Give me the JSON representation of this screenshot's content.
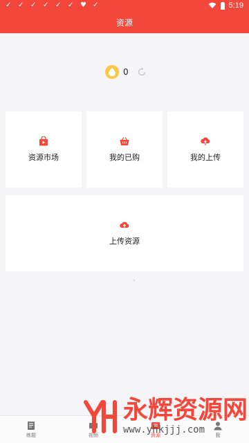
{
  "status_bar": {
    "time": "5:19"
  },
  "header": {
    "title": "资源"
  },
  "balance": {
    "value": "0"
  },
  "cards": [
    {
      "label": "资源市场",
      "icon": "shopping-bag-icon"
    },
    {
      "label": "我的已购",
      "icon": "basket-icon"
    },
    {
      "label": "我的上传",
      "icon": "cloud-upload-icon"
    },
    {
      "label": "上传资源",
      "icon": "cloud-upload-icon"
    }
  ],
  "bottom_nav": {
    "items": [
      {
        "label": "练题",
        "icon": "book-icon",
        "active": false
      },
      {
        "label": "视频",
        "icon": "video-icon",
        "active": false
      },
      {
        "label": "资源",
        "icon": "resource-icon",
        "active": true
      },
      {
        "label": "我",
        "icon": "person-icon",
        "active": false
      }
    ]
  },
  "watermark": {
    "title": "永辉资源网",
    "url": "www.yhkjjj.com"
  },
  "colors": {
    "accent": "#f2473a",
    "coin": "#f7c94a",
    "background": "#f5f5f7"
  }
}
